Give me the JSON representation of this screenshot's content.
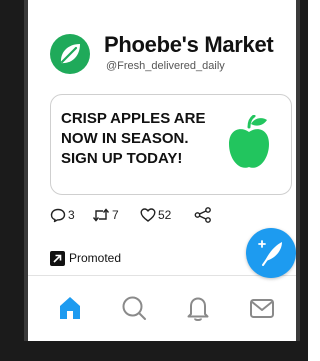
{
  "profile": {
    "name": "Phoebe's Market",
    "handle": "@Fresh_delivered_daily"
  },
  "ad": {
    "lines": [
      "CRISP APPLES ARE",
      "NOW IN SEASON.",
      "SIGN UP TODAY!"
    ],
    "image_icon": "green-apple-icon"
  },
  "actions": {
    "replies": "3",
    "retweets": "7",
    "likes": "52"
  },
  "promoted_label": "Promoted",
  "colors": {
    "brand_green": "#1faa5a",
    "apple_green": "#22c55e",
    "accent_blue": "#1d9bf0",
    "frame_dark": "#1b1b1b"
  },
  "tabs": [
    "home-icon",
    "search-icon",
    "notifications-icon",
    "messages-icon"
  ],
  "active_tab": "home-icon"
}
